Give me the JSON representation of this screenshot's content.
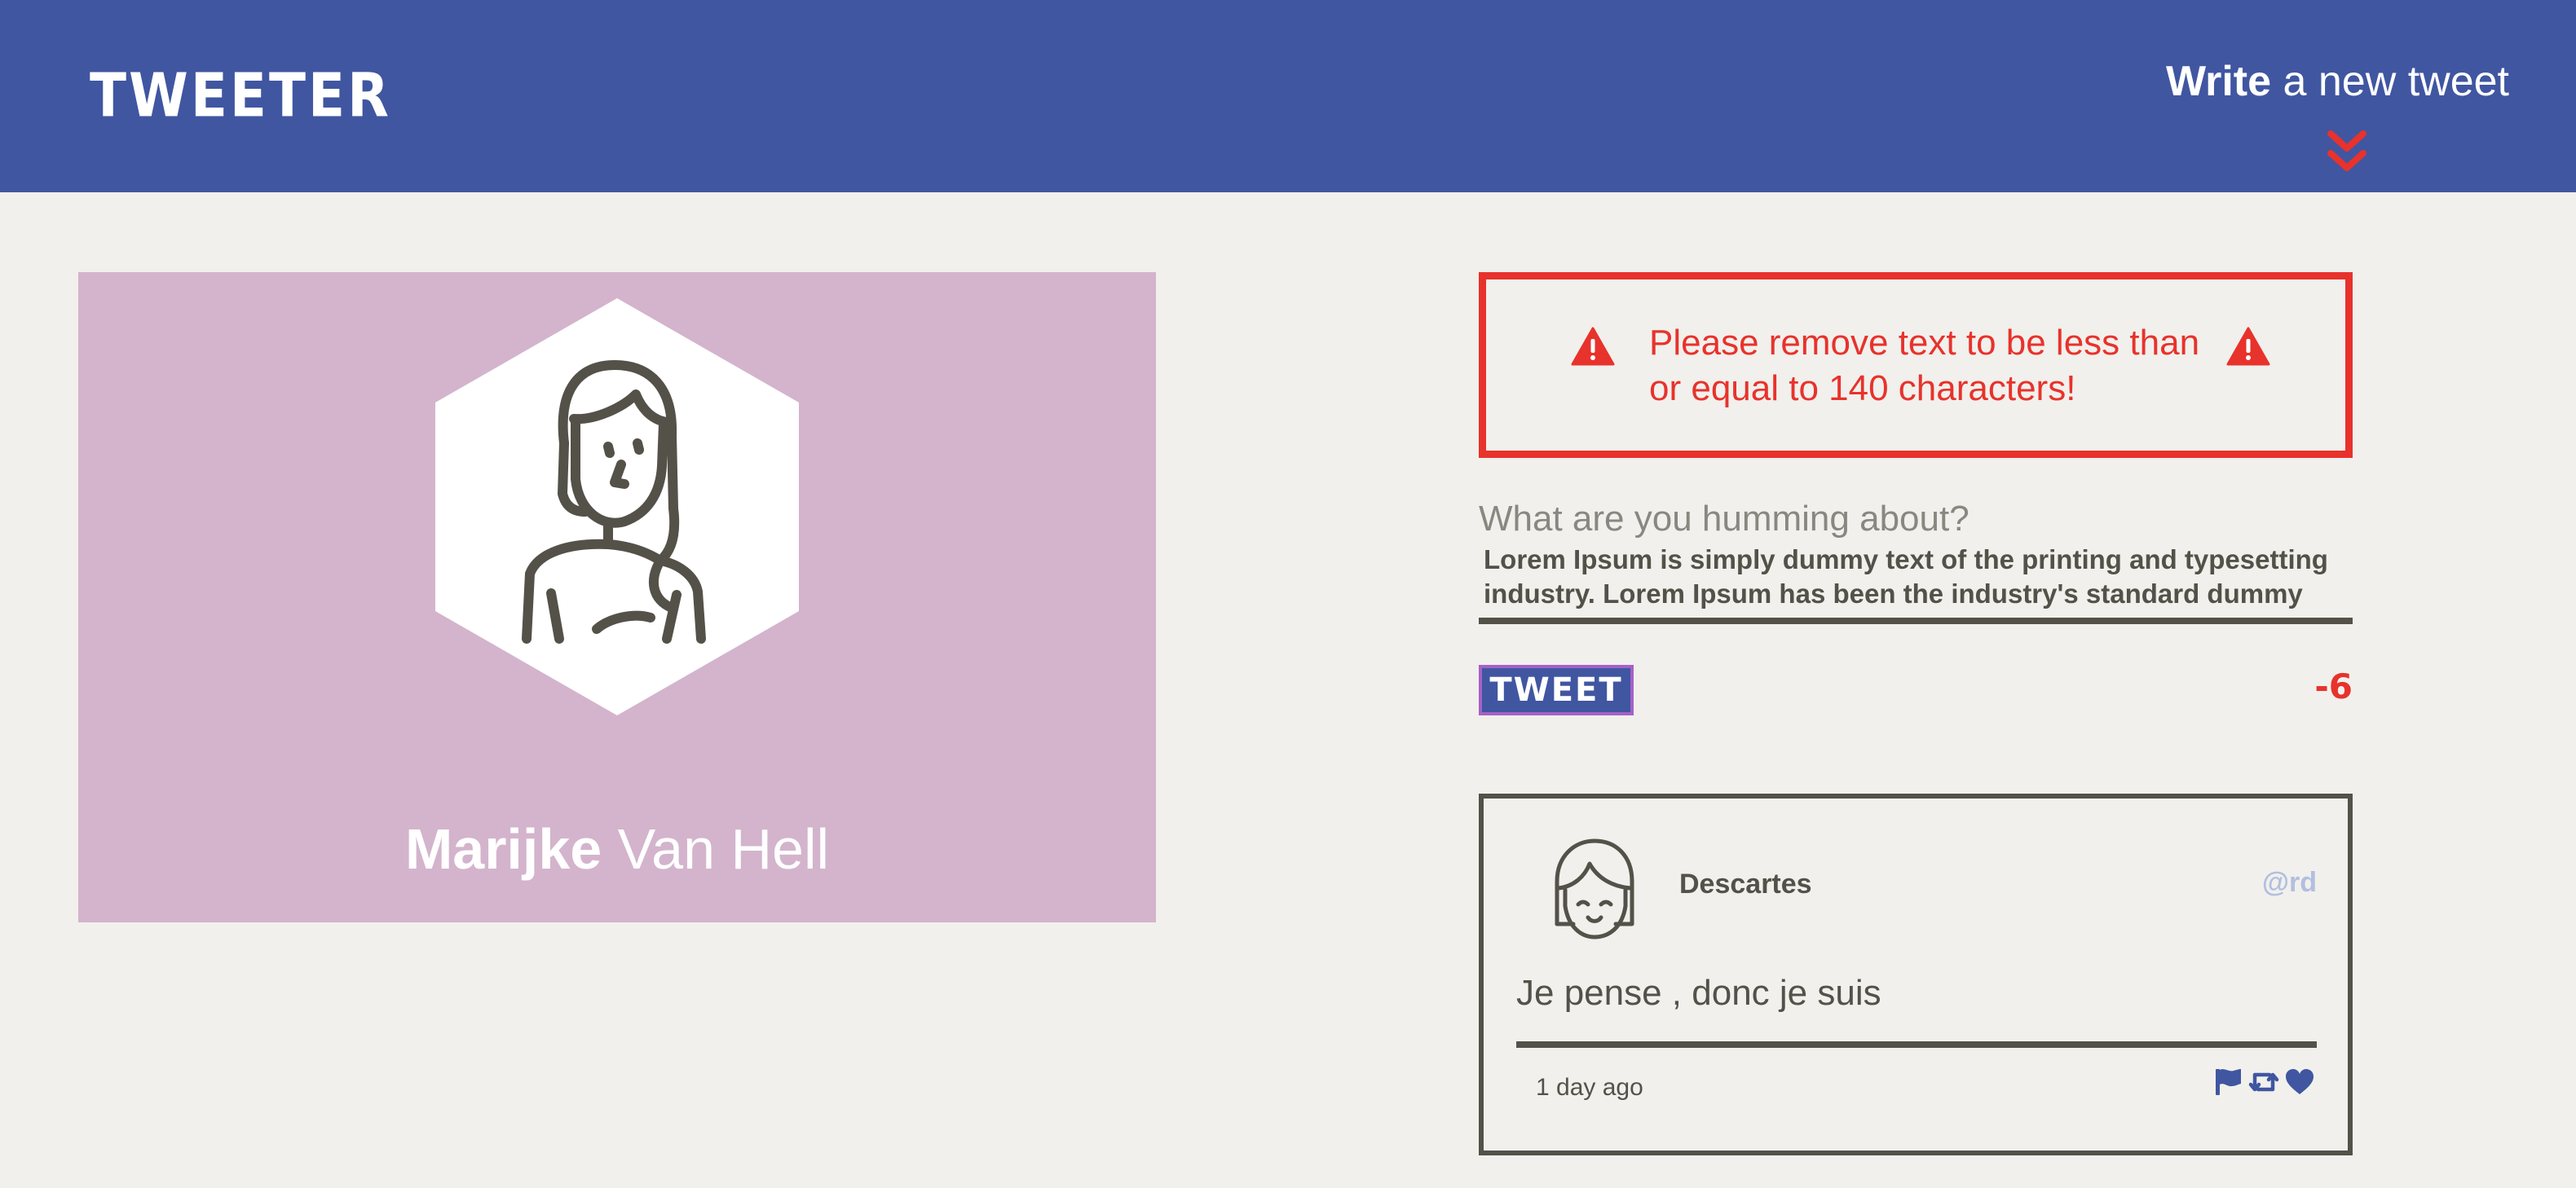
{
  "nav": {
    "brand": "TWEETER",
    "compose_bold": "Write",
    "compose_rest": " a new tweet",
    "compose_icon": "double-chevron-down-icon"
  },
  "profile": {
    "first_name": "Marijke",
    "last_name": " Van Hell",
    "avatar_icon": "woman-avatar-icon",
    "background_color": "#d3b4cc"
  },
  "error": {
    "message": "Please remove text to be less than or equal to 140 characters!",
    "icon": "warning-triangle-icon",
    "color": "#e8322c"
  },
  "form": {
    "label": "What are you humming about?",
    "value": "Lorem Ipsum is simply dummy text of the printing and typesetting industry. Lorem Ipsum has been the industry's standard dummy text",
    "button_label": "TWEET",
    "counter": "-6"
  },
  "tweet": {
    "name": "Descartes",
    "handle": "@rd",
    "avatar_icon": "girl-face-avatar-icon",
    "content": "Je pense , donc je suis",
    "time": "1 day ago",
    "actions": [
      "flag-icon",
      "retweet-icon",
      "heart-icon"
    ]
  },
  "colors": {
    "nav": "#4056a1",
    "page": "#f1f0ec",
    "text": "#545149",
    "accent_red": "#e8322c",
    "handle": "#b3bfe0"
  }
}
